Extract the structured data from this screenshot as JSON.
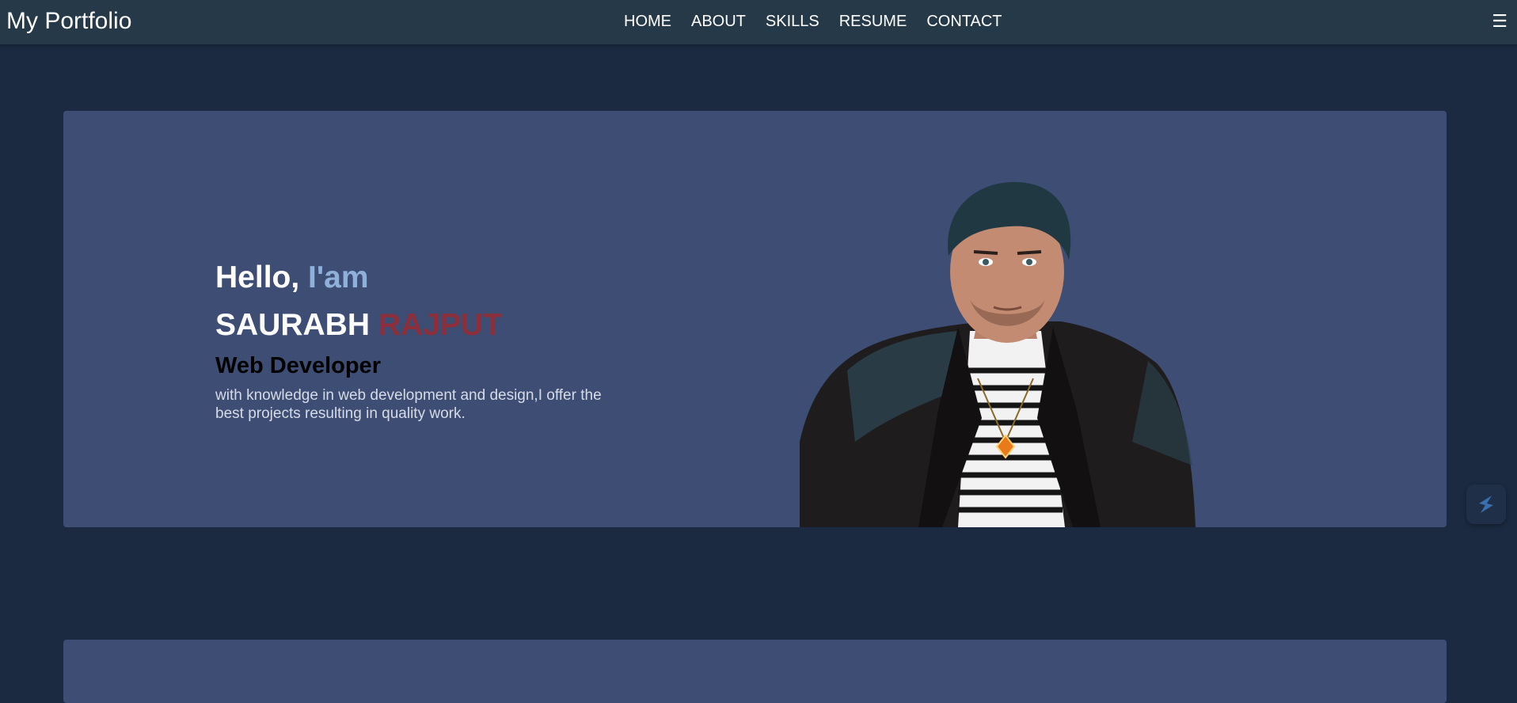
{
  "navbar": {
    "brand": "My Portfolio",
    "links": [
      {
        "label": "HOME"
      },
      {
        "label": "ABOUT"
      },
      {
        "label": "SKILLS"
      },
      {
        "label": "RESUME"
      },
      {
        "label": "CONTACT"
      }
    ],
    "menu_icon": "hamburger-icon",
    "menu_glyph": "☰"
  },
  "hero": {
    "greeting": "Hello,",
    "greeting_accent": "I'am",
    "first_name": "SAURABH",
    "last_name": "RAJPUT",
    "role": "Web Developer",
    "tagline": "with knowledge in web development and design,I offer the best projects resulting in quality work.",
    "portrait_icon": "profile-portrait-image"
  },
  "side_badge": {
    "icon": "extension-logo-icon"
  },
  "colors": {
    "page_bg": "#1b2a41",
    "navbar_bg": "#253948",
    "card_bg": "#3d4d74",
    "greeting_accent": "#8fb0d8",
    "surname": "#8c2f3a"
  }
}
